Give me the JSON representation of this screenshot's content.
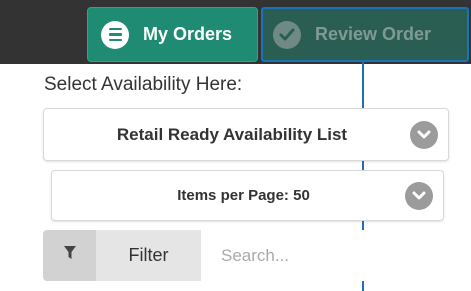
{
  "header": {
    "my_orders_label": "My Orders",
    "review_order_label": "Review Order"
  },
  "availability": {
    "section_label": "Select Availability Here:",
    "list_select_value": "Retail Ready Availability List",
    "items_per_page_value": "Items per Page: 50"
  },
  "filter": {
    "label": "Filter",
    "search_placeholder": "Search..."
  },
  "icons": {
    "menu": "menu-icon",
    "check": "check-icon",
    "chevron": "chevron-down-icon",
    "filter": "funnel-icon"
  },
  "colors": {
    "accent_green": "#1e8b72",
    "header_dark": "#333333",
    "focus_blue": "#1a73b8"
  }
}
